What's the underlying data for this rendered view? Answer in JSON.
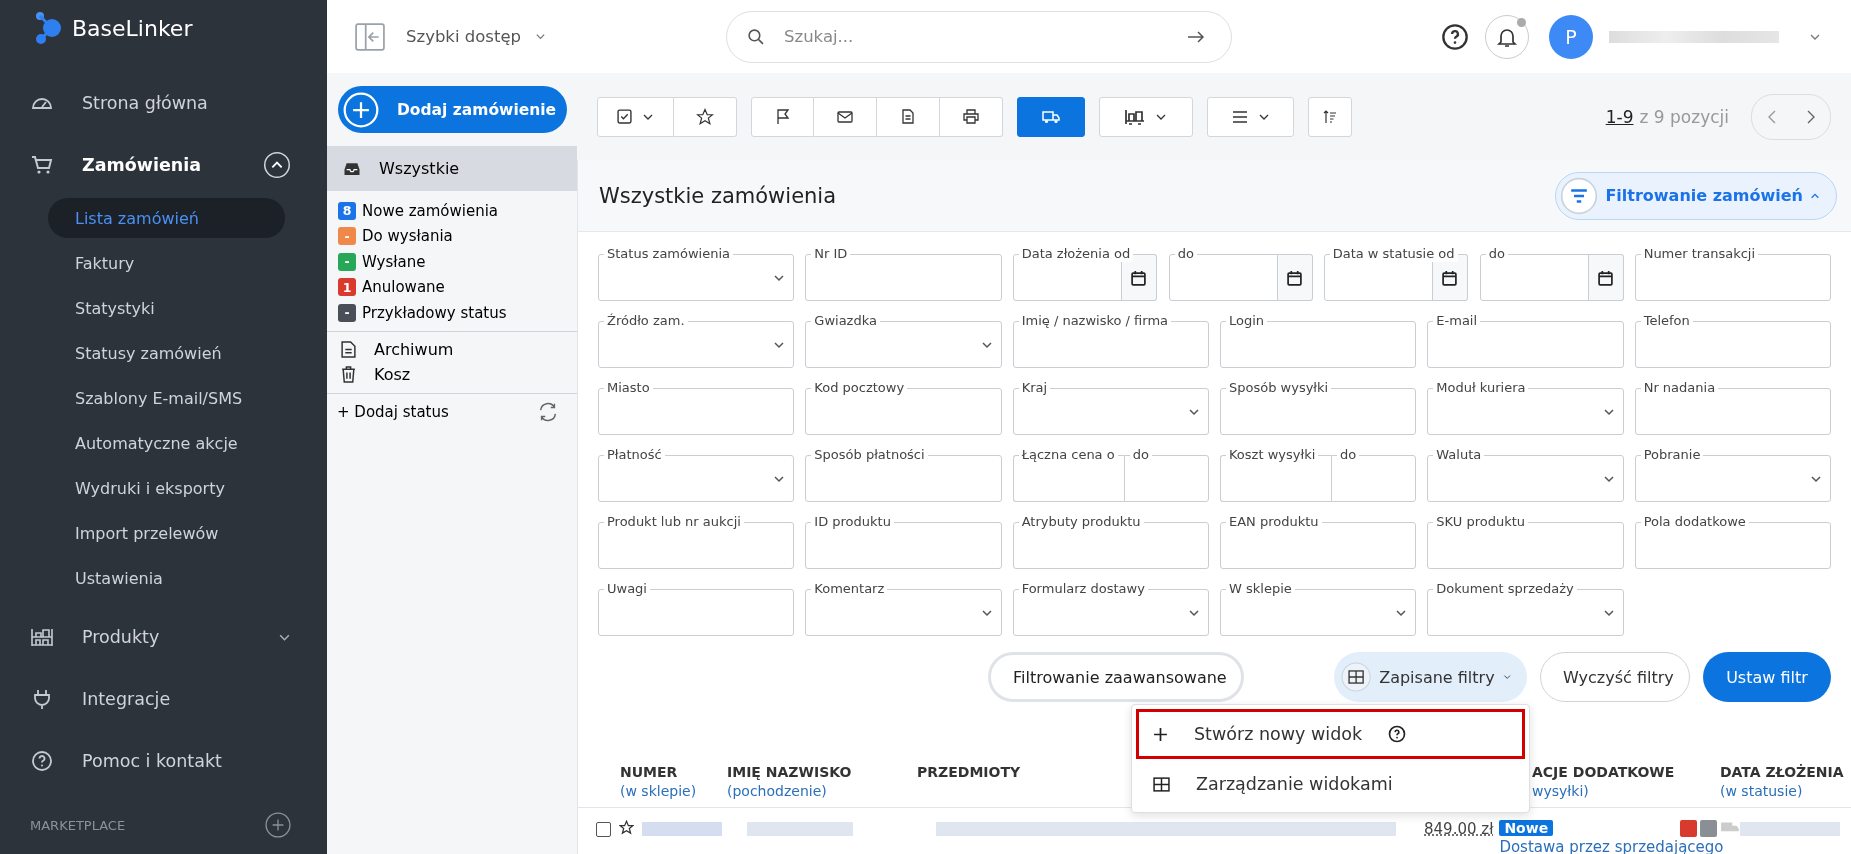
{
  "sidebar": {
    "logo": "BaseLinker",
    "items": [
      {
        "label": "Strona główna"
      },
      {
        "label": "Zamówienia",
        "expanded": true,
        "children": [
          {
            "label": "Lista zamówień",
            "selected": true
          },
          {
            "label": "Faktury",
            "selected": false
          },
          {
            "label": "Statystyki",
            "selected": false
          },
          {
            "label": "Statusy zamówień",
            "selected": false
          },
          {
            "label": "Szablony E-mail/SMS",
            "selected": false
          },
          {
            "label": "Automatyczne akcje",
            "selected": false
          },
          {
            "label": "Wydruki i eksporty",
            "selected": false
          },
          {
            "label": "Import przelewów",
            "selected": false
          },
          {
            "label": "Ustawienia",
            "selected": false
          }
        ]
      },
      {
        "label": "Produkty",
        "expanded": false
      },
      {
        "label": "Integracje"
      },
      {
        "label": "Pomoc i kontakt"
      }
    ],
    "section": "MARKETPLACE"
  },
  "topbar": {
    "quick_access": "Szybki dostęp",
    "search": {
      "placeholder": "Szukaj..."
    },
    "avatar": "P",
    "notification": true
  },
  "add_order": "Dodaj zamówienie",
  "statuses": {
    "all": {
      "label": "Wszystkie",
      "selected": true
    },
    "items": [
      {
        "count": "8",
        "label": "Nowe zamówienia",
        "color": "#1a73e8"
      },
      {
        "count": "-",
        "label": "Do wysłania",
        "color": "#f0884a"
      },
      {
        "count": "-",
        "label": "Wysłane",
        "color": "#27a859"
      },
      {
        "count": "1",
        "label": "Anulowane",
        "color": "#d93a2e"
      },
      {
        "count": "-",
        "label": "Przykładowy status",
        "color": "#4a4f57"
      }
    ],
    "archive": "Archiwum",
    "trash": "Kosz",
    "add_status": "+ Dodaj status"
  },
  "toolbar": {
    "shipping_active": true,
    "pagination": {
      "range": "1-9",
      "total": "z 9 pozycji"
    }
  },
  "panel": {
    "title": "Wszystkie zamówienia",
    "filter_toggle": "Filtrowanie zamówień",
    "filters_expanded": true,
    "fields": [
      {
        "kind": "select",
        "label": "Status zamówienia"
      },
      {
        "kind": "text",
        "label": "Nr ID"
      },
      {
        "kind": "daterange",
        "label": "Data złożenia od",
        "label_to": "do"
      },
      {
        "kind": "daterange",
        "label": "Data w statusie od",
        "label_to": "do"
      },
      {
        "kind": "text",
        "label": "Numer transakcji"
      },
      {
        "kind": "select",
        "label": "Źródło zam."
      },
      {
        "kind": "select",
        "label": "Gwiazdka"
      },
      {
        "kind": "text",
        "label": "Imię / nazwisko / firma"
      },
      {
        "kind": "text",
        "label": "Login"
      },
      {
        "kind": "text",
        "label": "E-mail"
      },
      {
        "kind": "text",
        "label": "Telefon"
      },
      {
        "kind": "text",
        "label": "Miasto"
      },
      {
        "kind": "text",
        "label": "Kod pocztowy"
      },
      {
        "kind": "select",
        "label": "Kraj"
      },
      {
        "kind": "text",
        "label": "Sposób wysyłki"
      },
      {
        "kind": "select",
        "label": "Moduł kuriera"
      },
      {
        "kind": "text",
        "label": "Nr nadania"
      },
      {
        "kind": "select",
        "label": "Płatność"
      },
      {
        "kind": "text",
        "label": "Sposób płatności"
      },
      {
        "kind": "range",
        "label": "Łączna cena o",
        "label_to": "do"
      },
      {
        "kind": "range",
        "label": "Koszt wysyłki",
        "label_to": "do"
      },
      {
        "kind": "select",
        "label": "Waluta"
      },
      {
        "kind": "select",
        "label": "Pobranie"
      },
      {
        "kind": "text",
        "label": "Produkt lub nr aukcji"
      },
      {
        "kind": "text",
        "label": "ID produktu"
      },
      {
        "kind": "text",
        "label": "Atrybuty produktu"
      },
      {
        "kind": "text",
        "label": "EAN produktu"
      },
      {
        "kind": "text",
        "label": "SKU produktu"
      },
      {
        "kind": "text",
        "label": "Pola dodatkowe"
      },
      {
        "kind": "text",
        "label": "Uwagi"
      },
      {
        "kind": "select",
        "label": "Komentarz"
      },
      {
        "kind": "select",
        "label": "Formularz dostawy"
      },
      {
        "kind": "select",
        "label": "W sklepie"
      },
      {
        "kind": "select",
        "label": "Dokument sprzedaży"
      }
    ],
    "advanced": "Filtrowanie zaawansowane",
    "saved": "Zapisane filtry",
    "clear": "Wyczyść filtry",
    "apply": "Ustaw filtr",
    "saved_menu": [
      {
        "kind": "create",
        "label": "Stwórz nowy widok",
        "highlighted": true
      },
      {
        "kind": "manage",
        "label": "Zarządzanie widokami",
        "highlighted": false
      }
    ]
  },
  "table": {
    "columns": [
      {
        "title": "NUMER",
        "sub": "(w sklepie)"
      },
      {
        "title": "IMIĘ NAZWISKO",
        "sub": "(pochodzenie)"
      },
      {
        "title": "PRZEDMIOTY"
      },
      {
        "title": "ACJE DODATKOWE",
        "sub": "wysyłki)"
      },
      {
        "title": "DATA ZŁOŻENIA",
        "sub": "(w statusie)"
      }
    ],
    "rows": [
      {
        "checked": false,
        "starred": false,
        "price": "849.00 zł",
        "status": "Nowe",
        "delivery": "Dostawa przez sprzedającego"
      }
    ]
  }
}
